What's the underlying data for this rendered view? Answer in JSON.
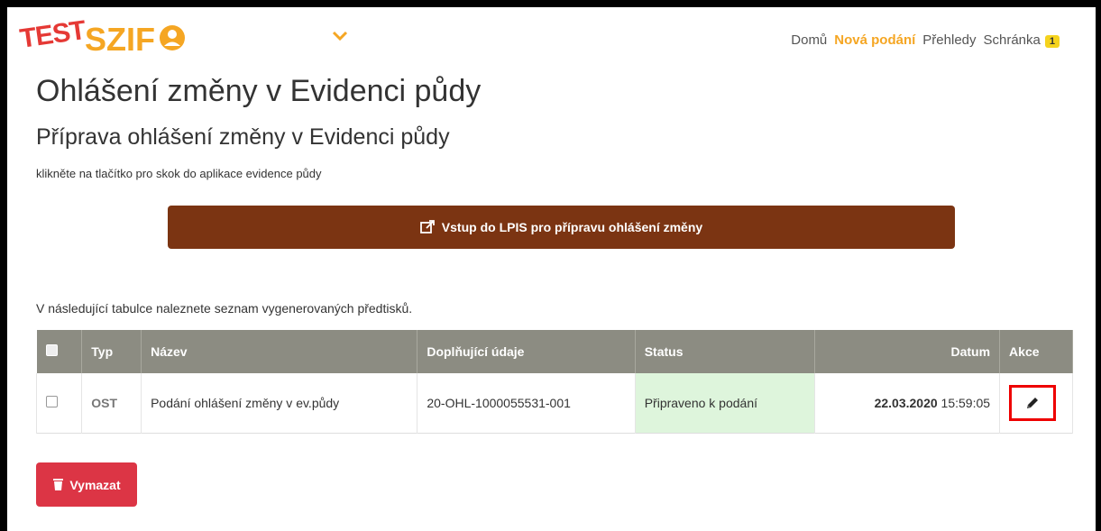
{
  "header": {
    "logo_test": "TEST",
    "logo_brand": "SZIF",
    "nav": {
      "home": "Domů",
      "new": "Nová podání",
      "overview": "Přehledy",
      "inbox": "Schránka",
      "inbox_count": "1"
    }
  },
  "page": {
    "title": "Ohlášení změny v Evidenci půdy",
    "subtitle": "Příprava ohlášení změny v Evidenci půdy",
    "hint": "klikněte na tlačítko pro skok do aplikace evidence půdy",
    "lpis_button": "Vstup do LPIS pro přípravu ohlášení změny",
    "table_caption": "V následující tabulce naleznete seznam vygenerovaných předtisků."
  },
  "table": {
    "headers": {
      "typ": "Typ",
      "nazev": "Název",
      "doplnujici": "Doplňující údaje",
      "status": "Status",
      "datum": "Datum",
      "akce": "Akce"
    },
    "rows": [
      {
        "typ": "OST",
        "nazev": "Podání ohlášení změny v ev.půdy",
        "doplnujici": "20-OHL-1000055531-001",
        "status": "Připraveno k podání",
        "date": "22.03.2020",
        "time": "15:59:05"
      }
    ]
  },
  "actions": {
    "delete": "Vymazat"
  },
  "colors": {
    "brand": "#f5a623",
    "lpis_button": "#7b3412",
    "delete_button": "#dc3545",
    "status_bg": "#def5dc",
    "table_header": "#8c8c82"
  },
  "icons": {
    "user": "user-circle-icon",
    "chevron": "chevron-down-icon",
    "external": "external-link-icon",
    "edit": "pencil-icon",
    "trash": "trash-icon"
  }
}
